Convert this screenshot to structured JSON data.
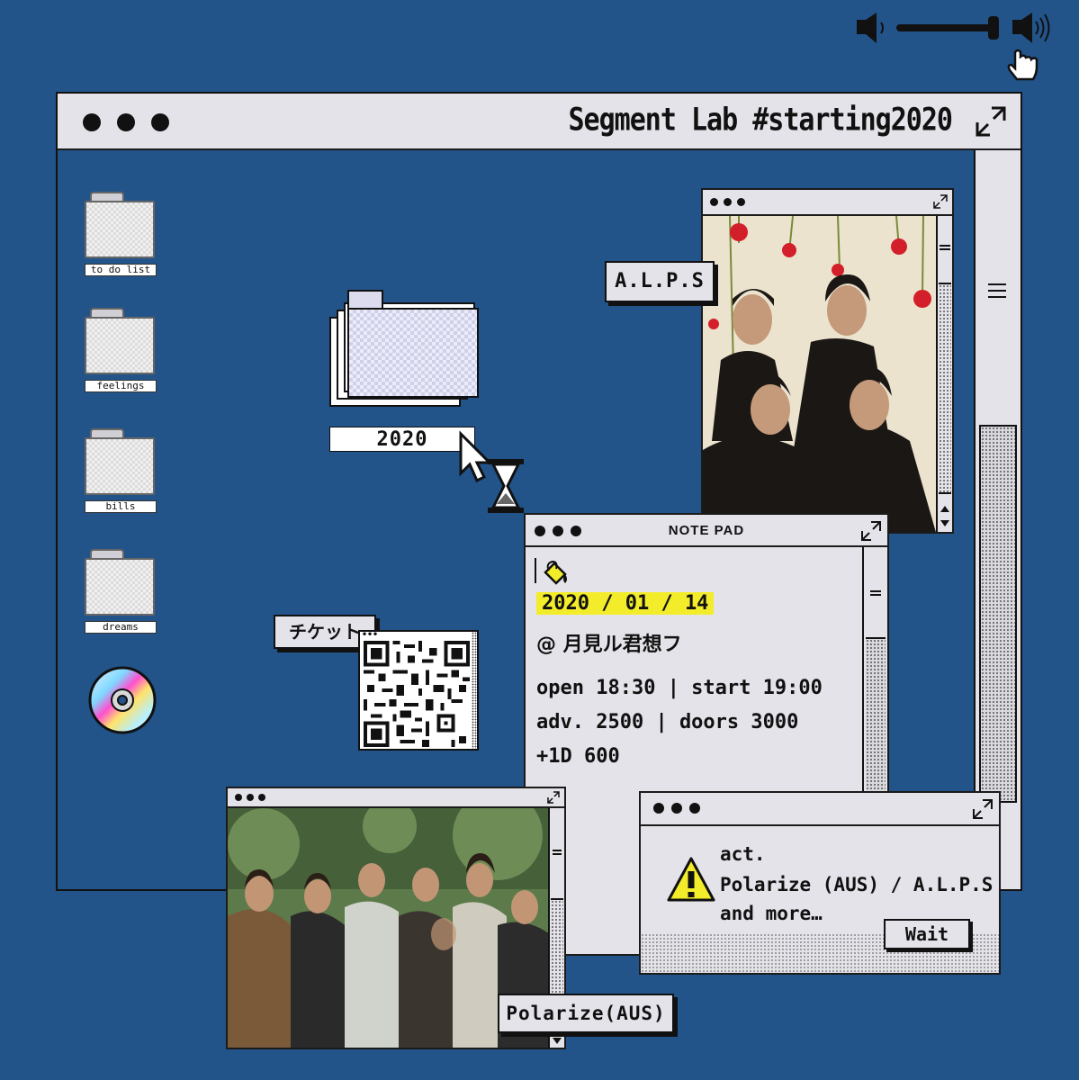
{
  "volume": {
    "level": 1.0
  },
  "main_window": {
    "title": "Segment Lab #starting2020"
  },
  "desktop": {
    "folders": [
      {
        "label": "to do list"
      },
      {
        "label": "feelings"
      },
      {
        "label": "bills"
      },
      {
        "label": "dreams"
      }
    ],
    "main_folder": {
      "label": "2020"
    }
  },
  "alps_window": {
    "label": "A.L.P.S"
  },
  "ticket": {
    "label": "チケット"
  },
  "notepad": {
    "title": "NOTE PAD",
    "date": "2020 / 01 / 14",
    "venue": "@ 月見ル君想フ",
    "times": "open 18:30 | start 19:00",
    "prices": "adv. 2500 | doors 3000",
    "drink": "+1D 600"
  },
  "alert": {
    "line1": "act.",
    "line2": "Polarize (AUS) / A.L.P.S",
    "line3": "and more…",
    "button": "Wait"
  },
  "polarize_window": {
    "label": "Polarize(AUS)"
  },
  "colors": {
    "background": "#22548a",
    "window": "#e4e3ea",
    "highlight": "#f3ec2b",
    "border": "#111111"
  }
}
